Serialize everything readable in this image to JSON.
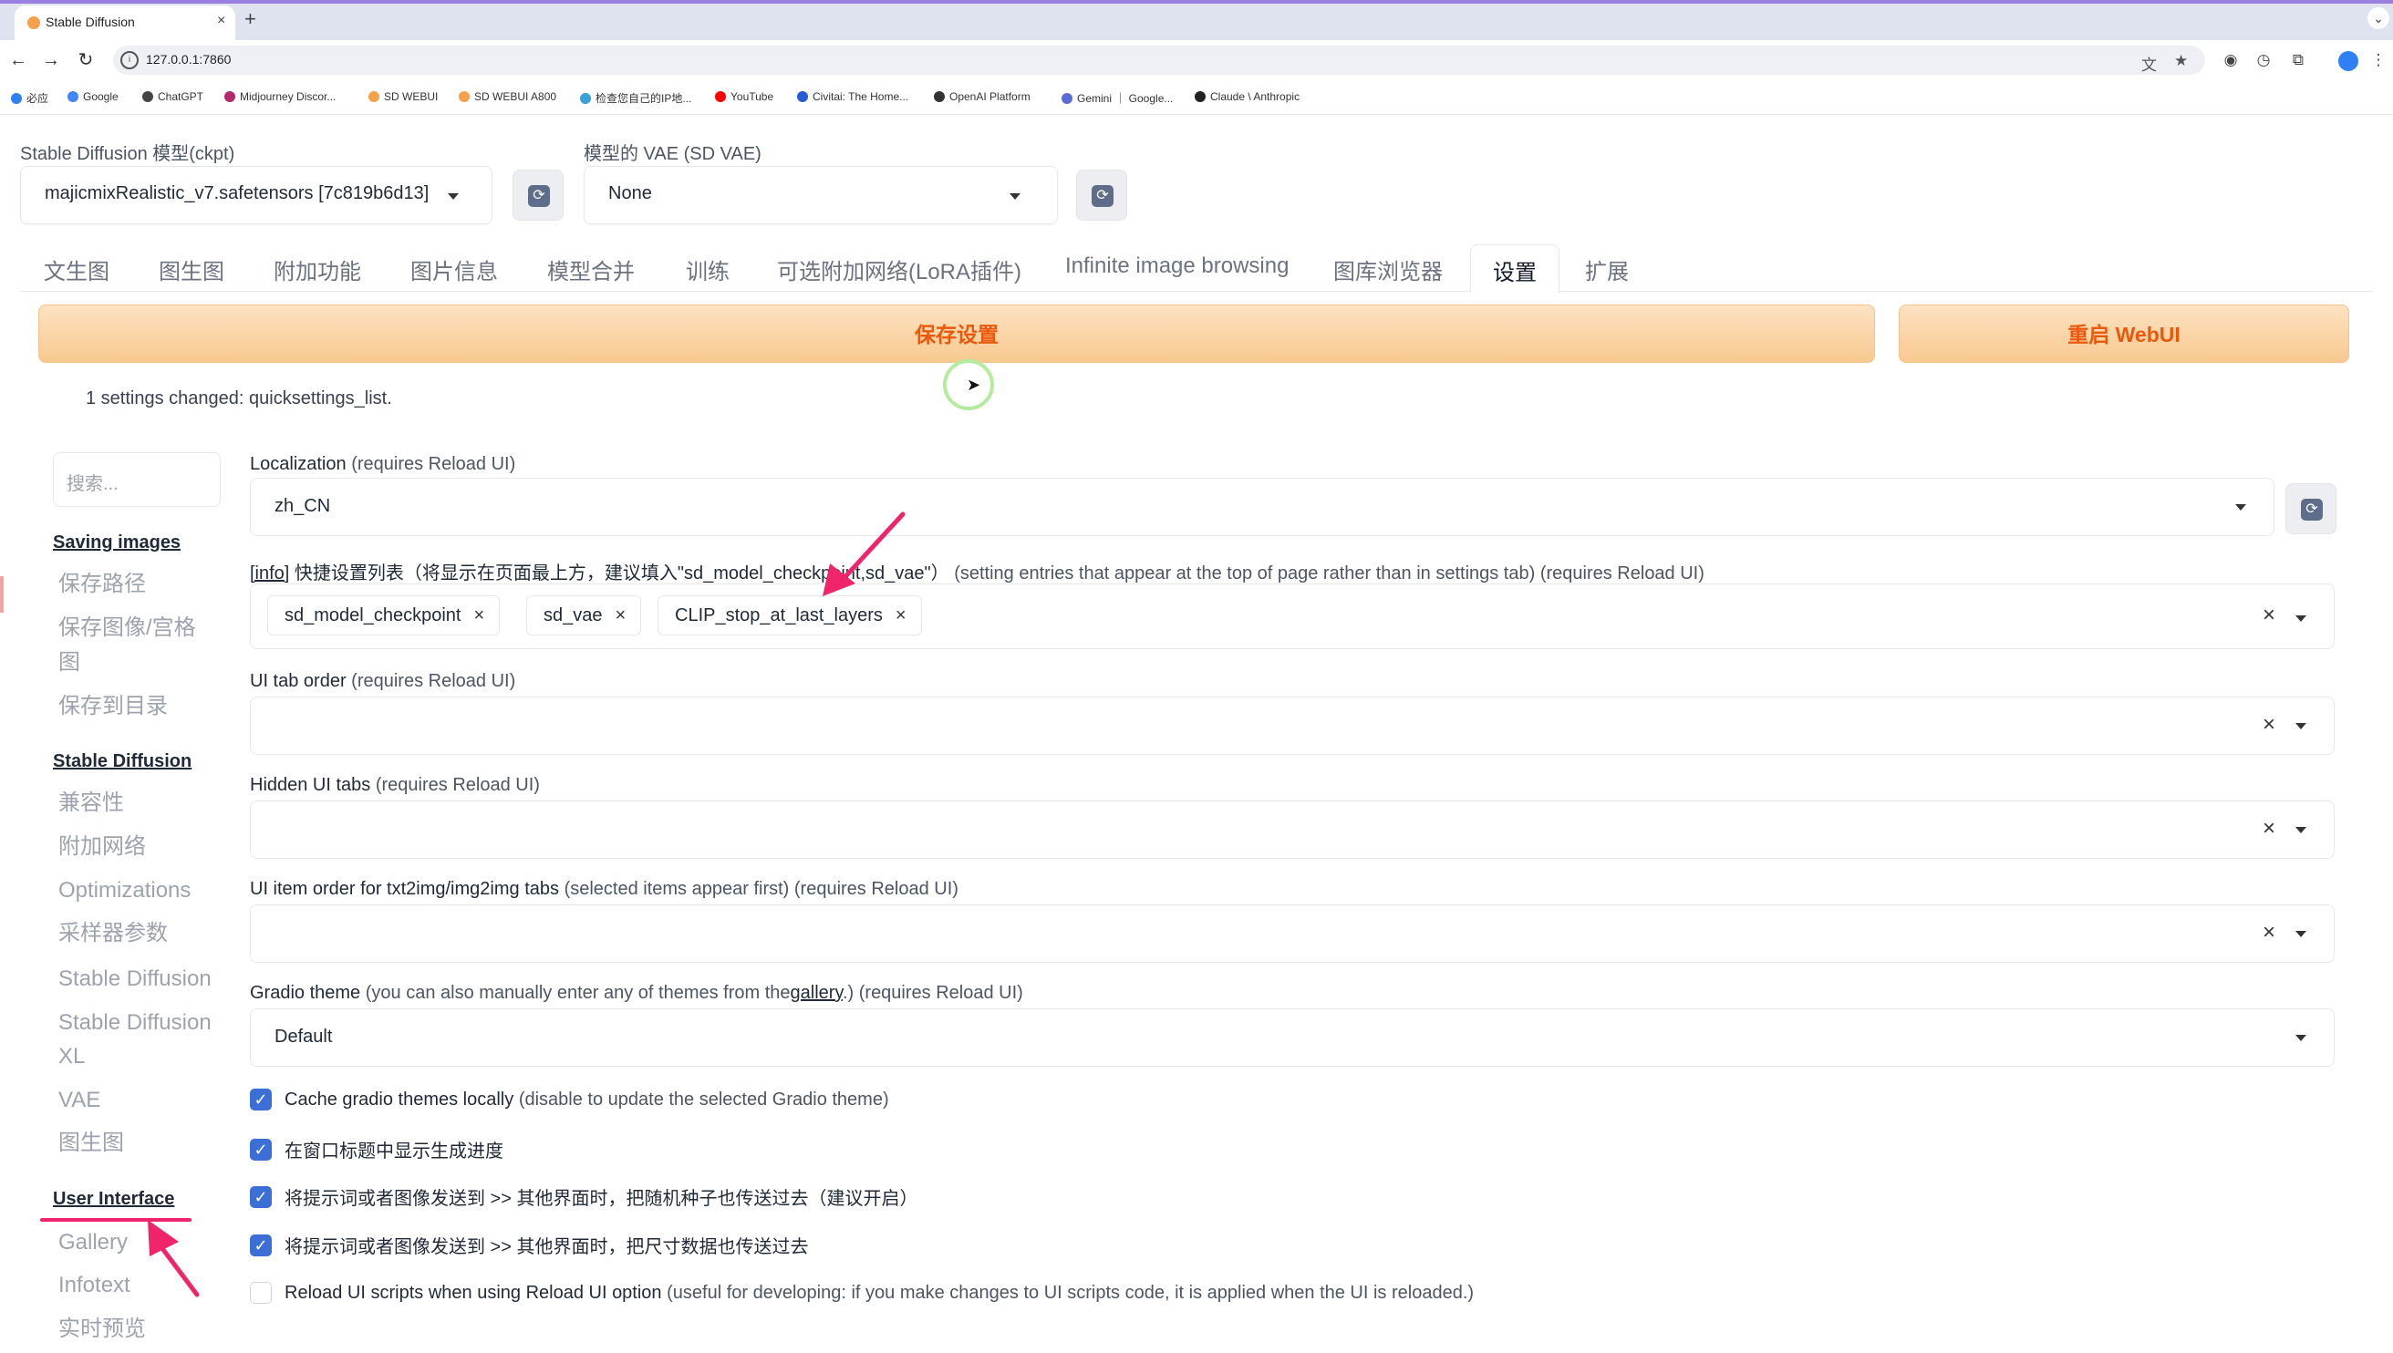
{
  "browser": {
    "tab_title": "Stable Diffusion",
    "new_tab": "+",
    "url": "127.0.0.1:7860",
    "bookmarks": [
      {
        "label": "必应",
        "color": "#2f7ff5"
      },
      {
        "label": "Google",
        "color": "#4285f4"
      },
      {
        "label": "ChatGPT",
        "color": "#444444"
      },
      {
        "label": "Midjourney Discor...",
        "color": "#b52a6d"
      },
      {
        "label": "SD WEBUI",
        "color": "#f5a04a"
      },
      {
        "label": "SD WEBUI A800",
        "color": "#f5a04a"
      },
      {
        "label": "检查您自己的IP地...",
        "color": "#3aa0d8"
      },
      {
        "label": "YouTube",
        "color": "#ff0000"
      },
      {
        "label": "Civitai: The Home...",
        "color": "#2a5bd7"
      },
      {
        "label": "OpenAI Platform",
        "color": "#333333"
      },
      {
        "label": "Gemini ｜ Google...",
        "color": "#5b6bd6"
      },
      {
        "label": "Claude \\ Anthropic",
        "color": "#222222"
      }
    ]
  },
  "top": {
    "ckpt_label": "Stable Diffusion 模型(ckpt)",
    "ckpt_value": "majicmixRealistic_v7.safetensors [7c819b6d13]",
    "vae_label": "模型的 VAE (SD VAE)",
    "vae_value": "None"
  },
  "tabs": [
    "文生图",
    "图生图",
    "附加功能",
    "图片信息",
    "模型合并",
    "训练",
    "可选附加网络(LoRA插件)",
    "Infinite image browsing",
    "图库浏览器",
    "设置",
    "扩展"
  ],
  "active_tab": "设置",
  "buttons": {
    "save": "保存设置",
    "restart": "重启 WebUI"
  },
  "changed_text": "1 settings changed: quicksettings_list.",
  "sidebar": {
    "search_placeholder": "搜索...",
    "sections": [
      {
        "head": "Saving images",
        "items": [
          "保存路径",
          "保存图像/宫格",
          "图",
          "保存到目录"
        ]
      },
      {
        "head": "Stable Diffusion",
        "items": [
          "兼容性",
          "附加网络",
          "Optimizations",
          "采样器参数",
          "Stable Diffusion",
          "Stable Diffusion",
          "XL",
          "VAE",
          "图生图"
        ]
      },
      {
        "head": "User Interface",
        "items": [
          "Gallery",
          "Infotext",
          "实时预览"
        ]
      }
    ]
  },
  "settings": {
    "localization": {
      "label": "Localization",
      "sub": "(requires Reload UI)",
      "value": "zh_CN"
    },
    "quicksettings": {
      "info": "[info]",
      "label": "快捷设置列表（将显示在页面最上方，建议填入\"sd_model_checkpoint,sd_vae\"）",
      "sub": "(setting entries that appear at the top of page rather than in settings tab) (requires Reload UI)",
      "chips": [
        "sd_model_checkpoint",
        "sd_vae",
        "CLIP_stop_at_last_layers"
      ],
      "chip_close": "×"
    },
    "tab_order": {
      "label": "UI tab order",
      "sub": "(requires Reload UI)"
    },
    "hidden_tabs": {
      "label": "Hidden UI tabs",
      "sub": "(requires Reload UI)"
    },
    "item_order": {
      "label": "UI item order for txt2img/img2img tabs",
      "sub": "(selected items appear first) (requires Reload UI)"
    },
    "theme": {
      "label": "Gradio theme",
      "sub_a": "(you can also manually enter any of themes from the",
      "link": "gallery",
      "sub_b": ".) (requires Reload UI)",
      "value": "Default"
    },
    "clear": "×",
    "checkboxes": [
      {
        "label": "Cache gradio themes locally",
        "sub": "(disable to update the selected Gradio theme)",
        "checked": true
      },
      {
        "label": "在窗口标题中显示生成进度",
        "sub": "",
        "checked": true
      },
      {
        "label": "将提示词或者图像发送到 >> 其他界面时，把随机种子也传送过去（建议开启）",
        "sub": "",
        "checked": true
      },
      {
        "label": "将提示词或者图像发送到 >> 其他界面时，把尺寸数据也传送过去",
        "sub": "",
        "checked": true
      },
      {
        "label": "Reload UI scripts when using Reload UI option",
        "sub": "(useful for developing: if you make changes to UI scripts code, it is applied when the UI is reloaded.)",
        "checked": false
      }
    ]
  },
  "icons": {
    "check": "✓",
    "refresh": "⟳",
    "back": "←",
    "forward": "→",
    "reload": "↻"
  },
  "colors": {
    "accent_orange": "#ea580c",
    "checkbox_blue": "#3b6fd6",
    "annotation_pink": "#f0246a"
  }
}
